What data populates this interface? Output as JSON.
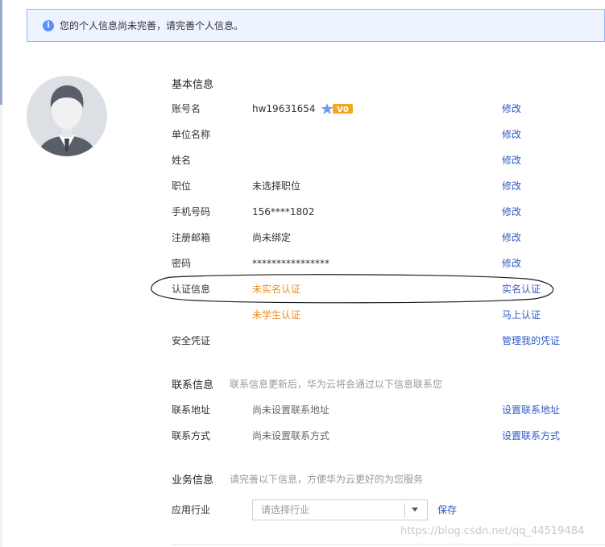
{
  "notice": {
    "icon": "info-icon",
    "text": "您的个人信息尚未完善，请完善个人信息。"
  },
  "avatar": {
    "icon": "user-avatar-icon"
  },
  "basic": {
    "title": "基本信息",
    "rows": [
      {
        "label": "账号名",
        "value": "hw19631654",
        "action": "修改"
      },
      {
        "label": "单位名称",
        "value": "",
        "action": "修改"
      },
      {
        "label": "姓名",
        "value": "",
        "action": "修改"
      },
      {
        "label": "职位",
        "value": "未选择职位",
        "action": "修改"
      },
      {
        "label": "手机号码",
        "value": "156****1802",
        "action": "修改"
      },
      {
        "label": "注册邮箱",
        "value": "尚未绑定",
        "action": "修改"
      },
      {
        "label": "密码",
        "value": "****************",
        "action": "修改"
      },
      {
        "label": "认证信息",
        "value": "未实名认证",
        "action": "实名认证"
      },
      {
        "label": "",
        "value": "未学生认证",
        "action": "马上认证"
      },
      {
        "label": "安全凭证",
        "value": "",
        "action": "管理我的凭证"
      }
    ],
    "badge": "V0",
    "accent_orange": "#f08a24",
    "link_color": "#2f5ac7"
  },
  "contact": {
    "title": "联系信息",
    "subtitle": "联系信息更新后，华为云将会通过以下信息联系您",
    "rows": [
      {
        "label": "联系地址",
        "value": "尚未设置联系地址",
        "action": "设置联系地址"
      },
      {
        "label": "联系方式",
        "value": "尚未设置联系方式",
        "action": "设置联系方式"
      }
    ]
  },
  "business": {
    "title": "业务信息",
    "subtitle": "请完善以下信息，方便华为云更好的为您服务",
    "industry_label": "应用行业",
    "industry_placeholder": "请选择行业",
    "save": "保存"
  },
  "watermark": "https://blog.csdn.net/qq_44519484"
}
